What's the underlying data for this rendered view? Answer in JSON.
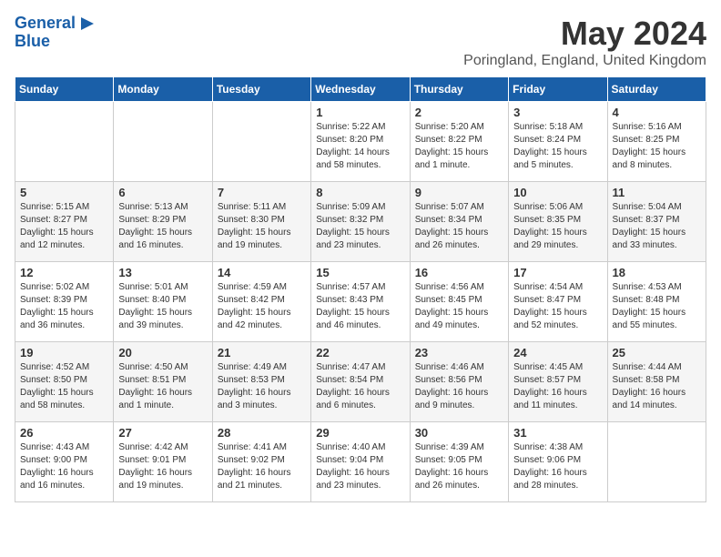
{
  "header": {
    "logo_line1": "General",
    "logo_line2": "Blue",
    "month": "May 2024",
    "location": "Poringland, England, United Kingdom"
  },
  "days_of_week": [
    "Sunday",
    "Monday",
    "Tuesday",
    "Wednesday",
    "Thursday",
    "Friday",
    "Saturday"
  ],
  "weeks": [
    [
      {
        "day": "",
        "info": ""
      },
      {
        "day": "",
        "info": ""
      },
      {
        "day": "",
        "info": ""
      },
      {
        "day": "1",
        "info": "Sunrise: 5:22 AM\nSunset: 8:20 PM\nDaylight: 14 hours and 58 minutes."
      },
      {
        "day": "2",
        "info": "Sunrise: 5:20 AM\nSunset: 8:22 PM\nDaylight: 15 hours and 1 minute."
      },
      {
        "day": "3",
        "info": "Sunrise: 5:18 AM\nSunset: 8:24 PM\nDaylight: 15 hours and 5 minutes."
      },
      {
        "day": "4",
        "info": "Sunrise: 5:16 AM\nSunset: 8:25 PM\nDaylight: 15 hours and 8 minutes."
      }
    ],
    [
      {
        "day": "5",
        "info": "Sunrise: 5:15 AM\nSunset: 8:27 PM\nDaylight: 15 hours and 12 minutes."
      },
      {
        "day": "6",
        "info": "Sunrise: 5:13 AM\nSunset: 8:29 PM\nDaylight: 15 hours and 16 minutes."
      },
      {
        "day": "7",
        "info": "Sunrise: 5:11 AM\nSunset: 8:30 PM\nDaylight: 15 hours and 19 minutes."
      },
      {
        "day": "8",
        "info": "Sunrise: 5:09 AM\nSunset: 8:32 PM\nDaylight: 15 hours and 23 minutes."
      },
      {
        "day": "9",
        "info": "Sunrise: 5:07 AM\nSunset: 8:34 PM\nDaylight: 15 hours and 26 minutes."
      },
      {
        "day": "10",
        "info": "Sunrise: 5:06 AM\nSunset: 8:35 PM\nDaylight: 15 hours and 29 minutes."
      },
      {
        "day": "11",
        "info": "Sunrise: 5:04 AM\nSunset: 8:37 PM\nDaylight: 15 hours and 33 minutes."
      }
    ],
    [
      {
        "day": "12",
        "info": "Sunrise: 5:02 AM\nSunset: 8:39 PM\nDaylight: 15 hours and 36 minutes."
      },
      {
        "day": "13",
        "info": "Sunrise: 5:01 AM\nSunset: 8:40 PM\nDaylight: 15 hours and 39 minutes."
      },
      {
        "day": "14",
        "info": "Sunrise: 4:59 AM\nSunset: 8:42 PM\nDaylight: 15 hours and 42 minutes."
      },
      {
        "day": "15",
        "info": "Sunrise: 4:57 AM\nSunset: 8:43 PM\nDaylight: 15 hours and 46 minutes."
      },
      {
        "day": "16",
        "info": "Sunrise: 4:56 AM\nSunset: 8:45 PM\nDaylight: 15 hours and 49 minutes."
      },
      {
        "day": "17",
        "info": "Sunrise: 4:54 AM\nSunset: 8:47 PM\nDaylight: 15 hours and 52 minutes."
      },
      {
        "day": "18",
        "info": "Sunrise: 4:53 AM\nSunset: 8:48 PM\nDaylight: 15 hours and 55 minutes."
      }
    ],
    [
      {
        "day": "19",
        "info": "Sunrise: 4:52 AM\nSunset: 8:50 PM\nDaylight: 15 hours and 58 minutes."
      },
      {
        "day": "20",
        "info": "Sunrise: 4:50 AM\nSunset: 8:51 PM\nDaylight: 16 hours and 1 minute."
      },
      {
        "day": "21",
        "info": "Sunrise: 4:49 AM\nSunset: 8:53 PM\nDaylight: 16 hours and 3 minutes."
      },
      {
        "day": "22",
        "info": "Sunrise: 4:47 AM\nSunset: 8:54 PM\nDaylight: 16 hours and 6 minutes."
      },
      {
        "day": "23",
        "info": "Sunrise: 4:46 AM\nSunset: 8:56 PM\nDaylight: 16 hours and 9 minutes."
      },
      {
        "day": "24",
        "info": "Sunrise: 4:45 AM\nSunset: 8:57 PM\nDaylight: 16 hours and 11 minutes."
      },
      {
        "day": "25",
        "info": "Sunrise: 4:44 AM\nSunset: 8:58 PM\nDaylight: 16 hours and 14 minutes."
      }
    ],
    [
      {
        "day": "26",
        "info": "Sunrise: 4:43 AM\nSunset: 9:00 PM\nDaylight: 16 hours and 16 minutes."
      },
      {
        "day": "27",
        "info": "Sunrise: 4:42 AM\nSunset: 9:01 PM\nDaylight: 16 hours and 19 minutes."
      },
      {
        "day": "28",
        "info": "Sunrise: 4:41 AM\nSunset: 9:02 PM\nDaylight: 16 hours and 21 minutes."
      },
      {
        "day": "29",
        "info": "Sunrise: 4:40 AM\nSunset: 9:04 PM\nDaylight: 16 hours and 23 minutes."
      },
      {
        "day": "30",
        "info": "Sunrise: 4:39 AM\nSunset: 9:05 PM\nDaylight: 16 hours and 26 minutes."
      },
      {
        "day": "31",
        "info": "Sunrise: 4:38 AM\nSunset: 9:06 PM\nDaylight: 16 hours and 28 minutes."
      },
      {
        "day": "",
        "info": ""
      }
    ]
  ]
}
